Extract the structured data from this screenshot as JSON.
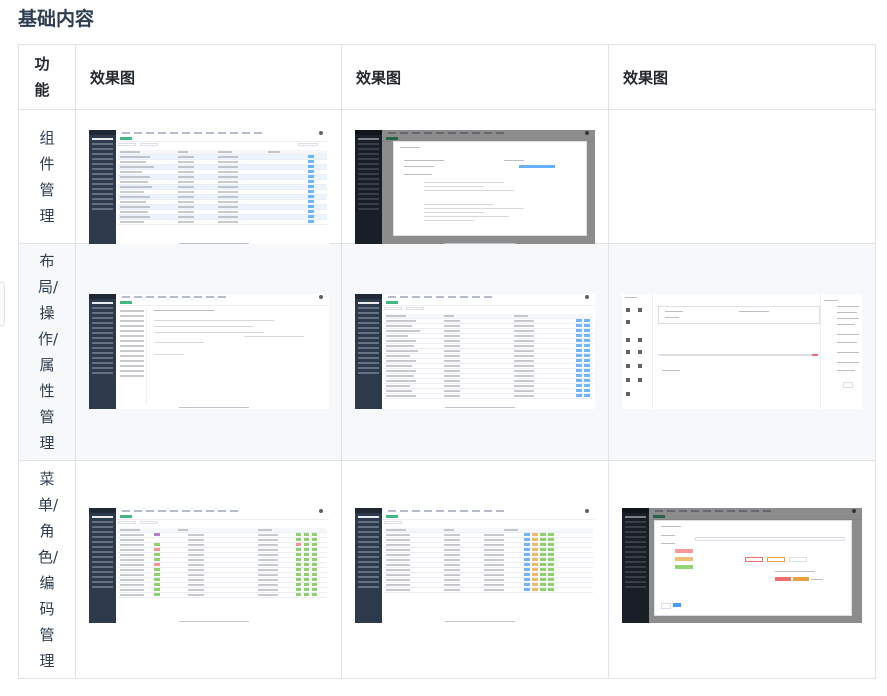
{
  "heading": "基础内容",
  "table": {
    "header": {
      "function": "功能",
      "preview_1": "效果图",
      "preview_2": "效果图",
      "preview_3": "效果图"
    },
    "rows": [
      {
        "function": "组件管理"
      },
      {
        "function": "布局/操作/属性管理"
      },
      {
        "function": "菜单/角色/编码管理"
      }
    ]
  },
  "colors": {
    "sidebar": "#2d3a4b",
    "accent_green": "#42b983",
    "accent_blue": "#409eff",
    "border": "#dfe2e5",
    "alt_row": "#f6f8fa"
  }
}
